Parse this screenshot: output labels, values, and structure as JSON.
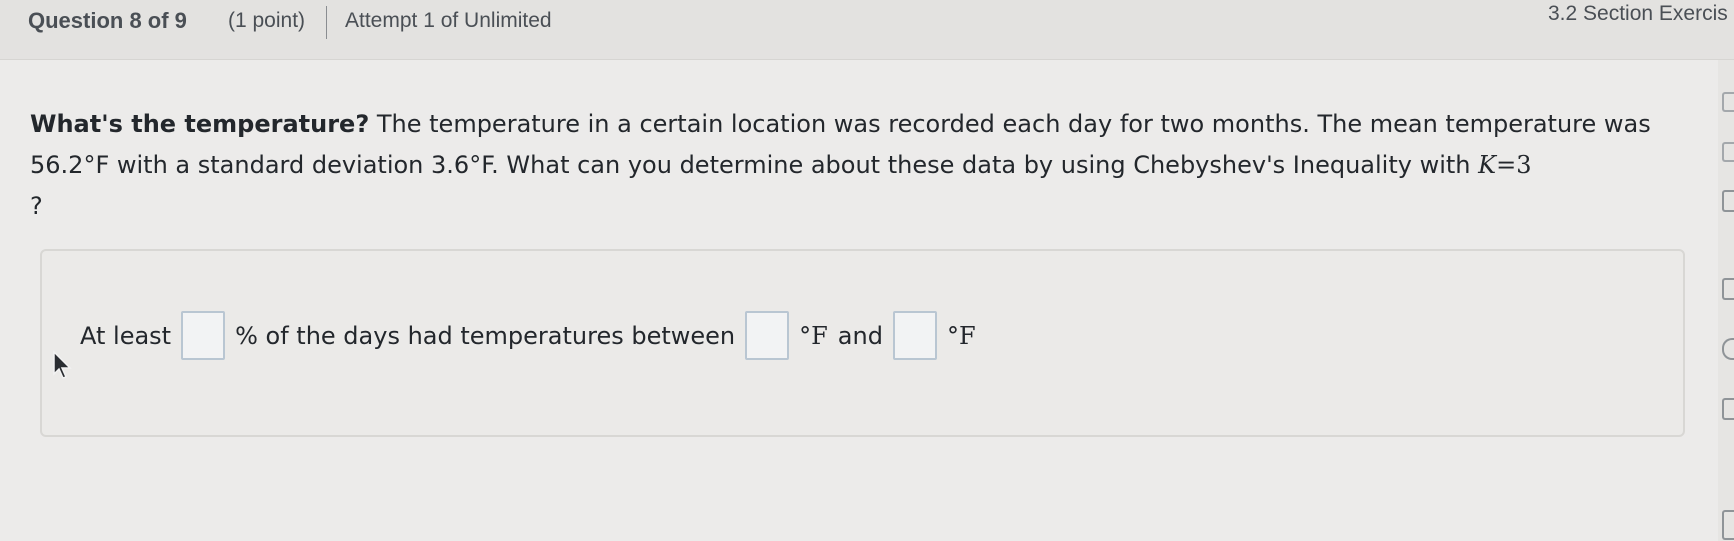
{
  "header": {
    "question_label": "Question 8 of 9",
    "points": "(1 point)",
    "attempt": "Attempt 1 of Unlimited",
    "section": "3.2 Section Exercis"
  },
  "question": {
    "title": "What's the temperature?",
    "text_a": " The temperature in a certain location was recorded each day for two months. The mean temperature was ",
    "mean": "56.2°F",
    "text_b": " with a standard deviation ",
    "sd": "3.6°F",
    "text_c": ". What can you determine about these data by using Chebyshev's Inequality with ",
    "k_var": "K",
    "k_eq": "=3",
    "text_end": "?"
  },
  "answer": {
    "prefix": "At least",
    "percent_text": "% of the days had temperatures between",
    "unit": "°F",
    "and_text": "and",
    "percent_value": "",
    "lower_value": "",
    "upper_value": ""
  }
}
